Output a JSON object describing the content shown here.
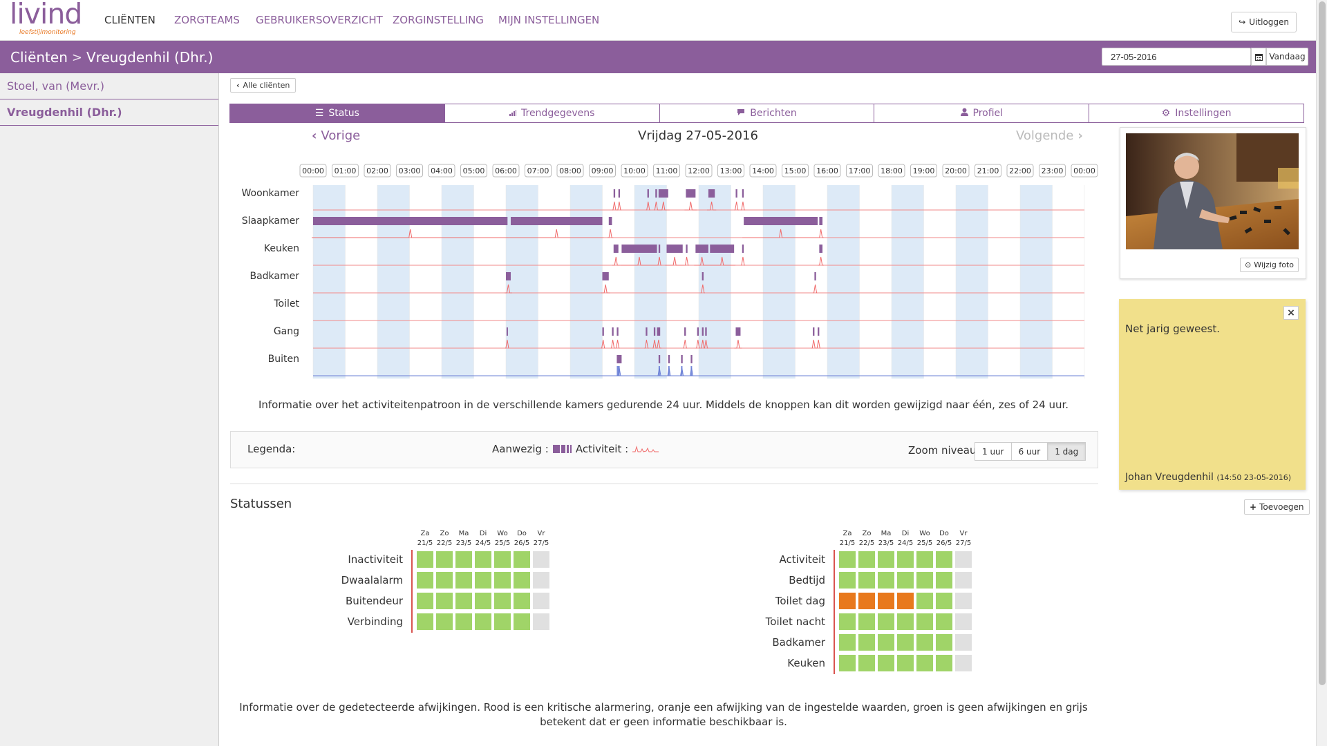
{
  "brand": {
    "logo_text": "livind",
    "tagline": "leefstijlmonitoring"
  },
  "nav": {
    "items": [
      "CLIËNTEN",
      "ZORGTEAMS",
      "GEBRUIKERSOVERZICHT",
      "ZORGINSTELLING",
      "MIJN INSTELLINGEN"
    ],
    "logout": "Uitloggen"
  },
  "header": {
    "crumb_root": "Cliënten",
    "crumb_current": "Vreugdenhil (Dhr.)",
    "date_value": "27-05-2016",
    "today_label": "Vandaag"
  },
  "sidebar": {
    "items": [
      "Stoel, van (Mevr.)",
      "Vreugdenhil (Dhr.)"
    ]
  },
  "main": {
    "back_label": "Alle cliënten",
    "tabs": [
      "Status",
      "Trendgegevens",
      "Berichten",
      "Profiel",
      "Instellingen"
    ],
    "prev_label": "Vorige",
    "day_title": "Vrijdag 27-05-2016",
    "next_label": "Volgende",
    "hours": [
      "00:00",
      "01:00",
      "02:00",
      "03:00",
      "04:00",
      "05:00",
      "06:00",
      "07:00",
      "08:00",
      "09:00",
      "10:00",
      "11:00",
      "12:00",
      "13:00",
      "14:00",
      "15:00",
      "16:00",
      "17:00",
      "18:00",
      "19:00",
      "20:00",
      "21:00",
      "22:00",
      "23:00",
      "00:00"
    ],
    "rooms": [
      {
        "name": "Woonkamer",
        "present": [
          [
            9.35,
            9.4
          ],
          [
            9.5,
            9.55
          ],
          [
            10.4,
            10.45
          ],
          [
            10.65,
            10.7
          ],
          [
            10.75,
            11.05
          ],
          [
            11.6,
            11.9
          ],
          [
            12.3,
            12.5
          ],
          [
            13.15,
            13.2
          ],
          [
            13.35,
            13.4
          ]
        ]
      },
      {
        "name": "Slaapkamer",
        "present": [
          [
            0,
            6.05
          ],
          [
            6.15,
            9.0
          ],
          [
            9.2,
            9.3
          ],
          [
            13.4,
            15.7
          ],
          [
            15.75,
            15.85
          ]
        ]
      },
      {
        "name": "Keuken",
        "present": [
          [
            9.35,
            9.5
          ],
          [
            9.6,
            10.7
          ],
          [
            10.75,
            10.8
          ],
          [
            11.0,
            11.5
          ],
          [
            11.6,
            11.65
          ],
          [
            11.9,
            12.3
          ],
          [
            12.35,
            13.1
          ],
          [
            13.35,
            13.4
          ],
          [
            15.75,
            15.85
          ]
        ]
      },
      {
        "name": "Badkamer",
        "present": [
          [
            6.0,
            6.15
          ],
          [
            9.0,
            9.2
          ],
          [
            12.1,
            12.15
          ],
          [
            15.6,
            15.65
          ]
        ]
      },
      {
        "name": "Toilet",
        "present": []
      },
      {
        "name": "Gang",
        "present": [
          [
            6.02,
            6.05
          ],
          [
            9.0,
            9.05
          ],
          [
            9.3,
            9.35
          ],
          [
            9.45,
            9.5
          ],
          [
            10.35,
            10.4
          ],
          [
            10.6,
            10.65
          ],
          [
            10.7,
            10.8
          ],
          [
            11.55,
            11.6
          ],
          [
            11.95,
            12.0
          ],
          [
            12.1,
            12.15
          ],
          [
            12.2,
            12.25
          ],
          [
            13.15,
            13.3
          ],
          [
            15.55,
            15.6
          ],
          [
            15.7,
            15.75
          ]
        ]
      },
      {
        "name": "Buiten",
        "present": [
          [
            9.45,
            9.6
          ],
          [
            10.75,
            10.8
          ],
          [
            11.05,
            11.1
          ],
          [
            11.45,
            11.5
          ],
          [
            11.75,
            11.8
          ]
        ]
      }
    ],
    "info_timeline": "Informatie over het activiteitenpatroon in de verschillende kamers gedurende 24 uur. Middels de knoppen kan dit worden gewijzigd naar één, zes of 24 uur.",
    "legend": {
      "label": "Legenda:",
      "present_label": "Aanwezig :",
      "activity_label": "Activiteit :",
      "zoom_label": "Zoom niveau:",
      "zoom_options": [
        "1 uur",
        "6 uur",
        "1 dag"
      ],
      "zoom_selected": "1 dag"
    },
    "statuses_title": "Statussen",
    "days": [
      {
        "d": "Za",
        "date": "21/5"
      },
      {
        "d": "Zo",
        "date": "22/5"
      },
      {
        "d": "Ma",
        "date": "23/5"
      },
      {
        "d": "Di",
        "date": "24/5"
      },
      {
        "d": "Wo",
        "date": "25/5"
      },
      {
        "d": "Do",
        "date": "26/5"
      },
      {
        "d": "Vr",
        "date": "27/5"
      }
    ],
    "status_left": [
      {
        "label": "Inactiviteit",
        "values": [
          "g",
          "g",
          "g",
          "g",
          "g",
          "g",
          "n"
        ]
      },
      {
        "label": "Dwaalalarm",
        "values": [
          "g",
          "g",
          "g",
          "g",
          "g",
          "g",
          "n"
        ]
      },
      {
        "label": "Buitendeur",
        "values": [
          "g",
          "g",
          "g",
          "g",
          "g",
          "g",
          "n"
        ]
      },
      {
        "label": "Verbinding",
        "values": [
          "g",
          "g",
          "g",
          "g",
          "g",
          "g",
          "n"
        ]
      }
    ],
    "status_right": [
      {
        "label": "Activiteit",
        "values": [
          "g",
          "g",
          "g",
          "g",
          "g",
          "g",
          "n"
        ]
      },
      {
        "label": "Bedtijd",
        "values": [
          "g",
          "g",
          "g",
          "g",
          "g",
          "g",
          "n"
        ]
      },
      {
        "label": "Toilet dag",
        "values": [
          "o",
          "o",
          "o",
          "o",
          "g",
          "g",
          "n"
        ]
      },
      {
        "label": "Toilet nacht",
        "values": [
          "g",
          "g",
          "g",
          "g",
          "g",
          "g",
          "n"
        ]
      },
      {
        "label": "Badkamer",
        "values": [
          "g",
          "g",
          "g",
          "g",
          "g",
          "g",
          "n"
        ]
      },
      {
        "label": "Keuken",
        "values": [
          "g",
          "g",
          "g",
          "g",
          "g",
          "g",
          "n"
        ]
      }
    ],
    "info_status": "Informatie over de gedetecteerde afwijkingen. Rood is een kritische alarmering, oranje een afwijking van de ingestelde waarden, groen is geen afwijkingen en grijs betekent dat er geen informatie beschikbaar is."
  },
  "right": {
    "photo_edit": "Wijzig foto",
    "note_text": "Net jarig geweest.",
    "note_author": "Johan Vreugdenhil",
    "note_time": "(14:50 23-05-2016)",
    "add_label": "Toevoegen"
  },
  "colors": {
    "brand_purple": "#8b5e9b",
    "accent_orange": "#e87722",
    "status_green": "#a0d468",
    "status_orange": "#e8791d",
    "status_none": "#e0e0e0",
    "hour_band": "#ddeaf7",
    "activity_line": "#f06a6a"
  }
}
